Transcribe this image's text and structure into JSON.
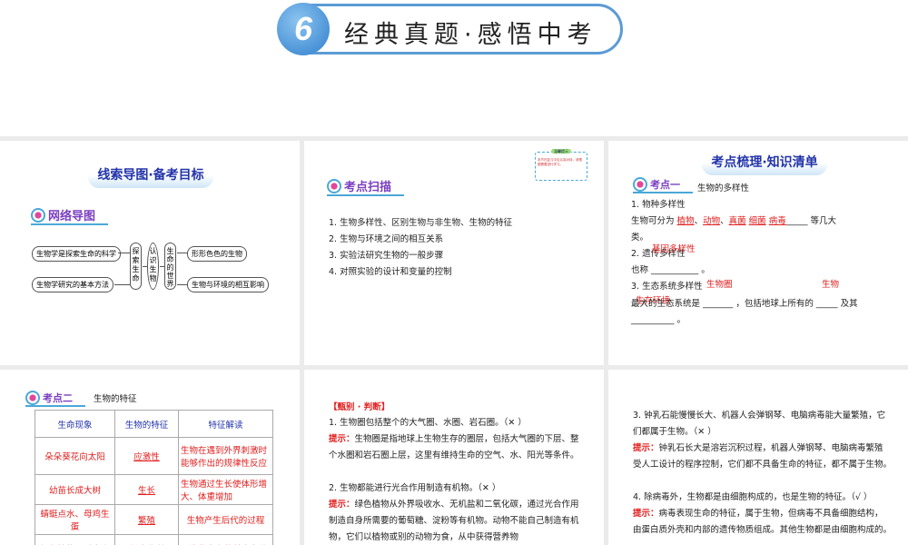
{
  "banner": {
    "number": "6",
    "title": "经典真题·感悟中考"
  },
  "panel1": {
    "title": "线索导图·备考目标",
    "badge": "网络导图",
    "left_boxes": [
      "生物学是探索生命的科学",
      "生物学研究的基本方法"
    ],
    "center_boxes": [
      "探索生命",
      "认识生物",
      "生命的世界"
    ],
    "right_boxes": [
      "形形色色的生物",
      "生物与环境的相互影响"
    ]
  },
  "panel2": {
    "badge": "考点扫描",
    "note_title": "温馨提示",
    "note_text": "本节在复习中应认真对待，请根据需要进行学习。",
    "items": [
      "1. 生物多样性、区别生物与非生物、生物的特征",
      "2. 生物与环境之间的相互关系",
      "3. 实验法研究生物的一般步骤",
      "4. 对照实验的设计和变量的控制"
    ]
  },
  "panel3": {
    "title": "考点梳理·知识清单",
    "badge": "考点一",
    "topic": "生物的多样性",
    "l1": "1. 物种多样性",
    "l2a": "生物可分为",
    "answers1": [
      "植物",
      "动物",
      "真菌",
      "细菌",
      "病毒"
    ],
    "l2b": "等几大",
    "l3": "类。",
    "l4": "2. 遗传多样性",
    "answer2": "基因多样性",
    "l5": "也称",
    "l6": "3. 生态系统多样性",
    "answer3a": "生物圈",
    "answer3b": "生物",
    "answer3c": "生存环境",
    "l7a": "最大的生态系统是",
    "l7b": "，包括地球上所有的",
    "l7c": "及其",
    "l8": "。"
  },
  "panel4": {
    "badge": "考点二",
    "topic": "生物的特征",
    "headers": [
      "生命现象",
      "生物的特征",
      "特征解读"
    ],
    "rows": [
      [
        "朵朵葵花向太阳",
        "应激性",
        "生物在遇到外界刺激时能够作出的规律性反应"
      ],
      [
        "幼苗长成大树",
        "生长",
        "生物通过生长使体形增大、体重增加"
      ],
      [
        "蜻蜓点水、母鸡生蛋",
        "繁殖",
        "生物产生后代的过程"
      ],
      [
        "绿色植物通过光合",
        "新陈代谢",
        "是生物生存的基本条件,"
      ]
    ]
  },
  "panel5": {
    "heading": "【甄别 · 判断】",
    "q1": "1. 生物圈包括整个的大气圈、水圈、岩石圈。（✕ ）",
    "hint_label": "提示：",
    "h1": "生物圈是指地球上生物生存的圈层，包括大气圈的下层、整个水圈和岩石圈上层，这里有维持生命的空气、水、阳光等条件。",
    "q2": "2. 生物都能进行光合作用制造有机物。（✕ ）",
    "h2": "绿色植物从外界吸收水、无机盐和二氧化碳，通过光合作用制造自身所需要的葡萄糖、淀粉等有机物。动物不能自己制造有机物，它们以植物或别的动物为食，从中获得营养物"
  },
  "panel6": {
    "q3": "3. 钟乳石能慢慢长大、机器人会弹钢琴、电脑病毒能大量繁殖，它们都属于生物。（✕ ）",
    "hint_label": "提示：",
    "h3": "钟乳石长大是溶岩沉积过程，机器人弹钢琴、电脑病毒繁殖受人工设计的程序控制，它们都不具备生命的特征，都不属于生物。",
    "q4": "4. 除病毒外，生物都是由细胞构成的，也是生物的特征。（√ ）",
    "h4": "病毒表现生命的特征，属于生物，但病毒不具备细胞结构，由蛋白质外壳和内部的遗传物质组成。其他生物都是由细胞构成的。"
  }
}
